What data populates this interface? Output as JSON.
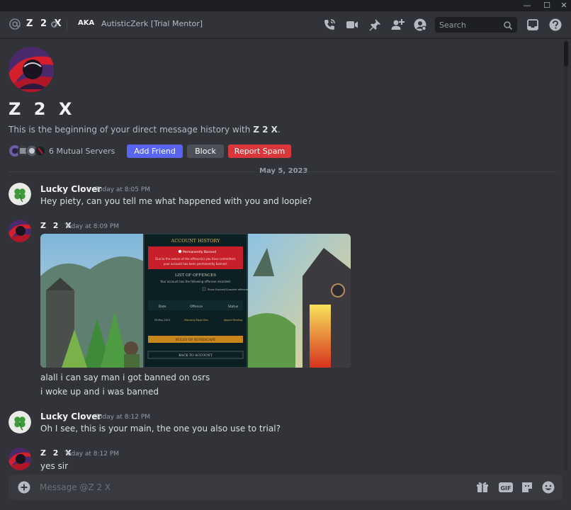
{
  "window": {
    "controls": {
      "minimize": "—",
      "maximize": "☐",
      "close": "✕"
    }
  },
  "header": {
    "username": "Z 2 X",
    "aka_label": "AKA",
    "nickname": "AutisticZerk [Trial Mentor]",
    "search_placeholder": "Search",
    "icons": [
      "call-icon",
      "video-call-icon",
      "pin-icon",
      "add-friends-to-dm-icon",
      "user-profile-icon",
      "search-icon",
      "inbox-icon",
      "help-icon"
    ]
  },
  "profile_intro": {
    "name": "Z 2 X",
    "description_prefix": "This is the beginning of your direct message history with ",
    "description_name": "Z 2 X",
    "description_suffix": ".",
    "mutual_servers": "6 Mutual Servers",
    "buttons": {
      "add_friend": "Add Friend",
      "block": "Block",
      "report_spam": "Report Spam"
    }
  },
  "date_divider": "May 5, 2023",
  "messages": [
    {
      "author": "Lucky Clover",
      "timestamp": "Today at 8:05 PM",
      "lines": [
        "Hey piety, can you tell me what happened with you and loopie?"
      ]
    },
    {
      "author": "Z 2 X",
      "timestamp": "Today at 8:09 PM",
      "attachment": {
        "title": "ACCOUNT HISTORY",
        "banner_title": "Permanently Banned",
        "banner_line1": "Due to the nature of the offence(s) you have committed,",
        "banner_line2": "your account has been permanently banned.",
        "list_title": "LIST OF OFFENCES",
        "list_subtitle": "Your account has the following offences recorded:",
        "checkbox_label": "Show Expired/Quashed offences",
        "columns": [
          "Date",
          "Offence",
          "Status"
        ],
        "rows": [
          [
            "05-May-2023",
            "Macroing Major Ban",
            "Appeal Pending"
          ]
        ],
        "primary_button": "RULES OF RUNESCAPE",
        "secondary_button": "BACK TO ACCOUNT"
      },
      "lines": [
        "alall i can say man i got banned on osrs",
        "i woke up and i was banned"
      ]
    },
    {
      "author": "Lucky Clover",
      "timestamp": "Today at 8:12 PM",
      "lines": [
        "Oh I see, this is your main, the one you also use to trial?"
      ]
    },
    {
      "author": "Z 2 X",
      "timestamp": "Today at 8:12 PM",
      "lines": [
        "yes sir"
      ]
    }
  ],
  "composer": {
    "placeholder": "Message @Z 2 X",
    "icons": [
      "attach-plus-icon",
      "gift-icon",
      "gif-icon",
      "sticker-icon",
      "emoji-icon"
    ],
    "gif_label": "GIF"
  },
  "colors": {
    "accent": "#5865f2",
    "danger": "#da373c",
    "background": "#313338"
  }
}
